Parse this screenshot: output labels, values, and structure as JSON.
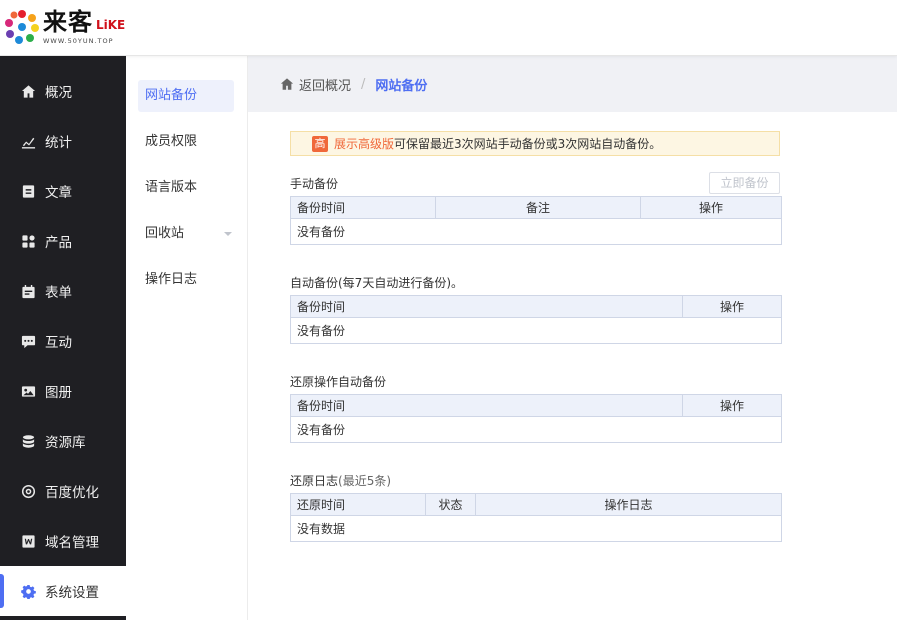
{
  "brand": {
    "name_cn": "来客",
    "name_en": "LiKE",
    "url": "WWW.50YUN.TOP"
  },
  "sidebar": {
    "items": [
      {
        "label": "概况",
        "icon": "home-icon"
      },
      {
        "label": "统计",
        "icon": "stats-icon"
      },
      {
        "label": "文章",
        "icon": "article-icon"
      },
      {
        "label": "产品",
        "icon": "product-icon"
      },
      {
        "label": "表单",
        "icon": "form-icon"
      },
      {
        "label": "互动",
        "icon": "chat-icon"
      },
      {
        "label": "图册",
        "icon": "album-icon"
      },
      {
        "label": "资源库",
        "icon": "database-icon"
      },
      {
        "label": "百度优化",
        "icon": "seo-icon"
      },
      {
        "label": "域名管理",
        "icon": "domain-icon"
      },
      {
        "label": "系统设置",
        "icon": "gear-icon"
      }
    ],
    "active": "系统设置",
    "accent": "#4e6ef2"
  },
  "submenu": {
    "items": [
      {
        "label": "网站备份"
      },
      {
        "label": "成员权限"
      },
      {
        "label": "语言版本"
      },
      {
        "label": "回收站"
      },
      {
        "label": "操作日志"
      }
    ],
    "active": "网站备份"
  },
  "breadcrumb": {
    "home_label": "返回概况",
    "separator": "/",
    "current": "网站备份"
  },
  "notice": {
    "badge": "高",
    "link_text": "展示高级版",
    "message": "可保留最近3次网站手动备份或3次网站自动备份。"
  },
  "manual_backup": {
    "title": "手动备份",
    "button_label": "立即备份",
    "columns": [
      "备份时间",
      "备注",
      "操作"
    ],
    "empty_text": "没有备份"
  },
  "auto_backup": {
    "title": "自动备份(每7天自动进行备份)。",
    "columns": [
      "备份时间",
      "操作"
    ],
    "empty_text": "没有备份"
  },
  "restore_backup": {
    "title": "还原操作自动备份",
    "columns": [
      "备份时间",
      "操作"
    ],
    "empty_text": "没有备份"
  },
  "restore_log": {
    "title": "还原日志",
    "subtitle": "(最近5条)",
    "columns": [
      "还原时间",
      "状态",
      "操作日志"
    ],
    "empty_text": "没有数据"
  }
}
